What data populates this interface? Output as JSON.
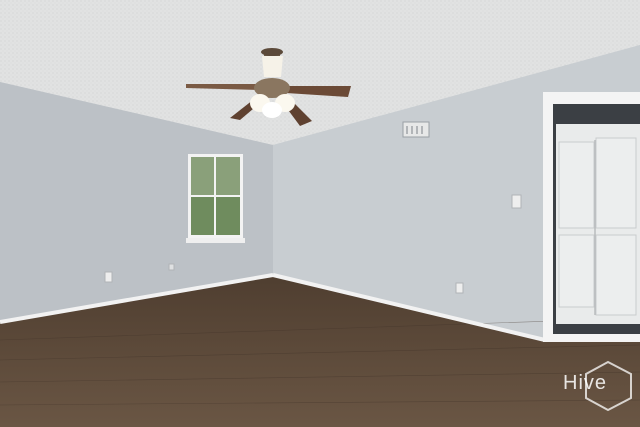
{
  "scene": {
    "description_type": "empty-room-photo",
    "colors": {
      "ceiling": "#e3e4e4",
      "wall_left": "#bcc1c6",
      "wall_back": "#c8cdd1",
      "floor": "#5e4a3a",
      "baseboard": "#f2f2f2",
      "door_trim": "#f4f4f4",
      "closet_doors": "#e9ebeb",
      "fan_blade": "#6b4a36",
      "window_glass": "#8aa07a"
    },
    "icons": [
      "ceiling-fan-icon",
      "window-icon",
      "vent-icon",
      "outlet-icon",
      "light-switch-icon"
    ]
  },
  "watermark": {
    "text": "Hive"
  }
}
